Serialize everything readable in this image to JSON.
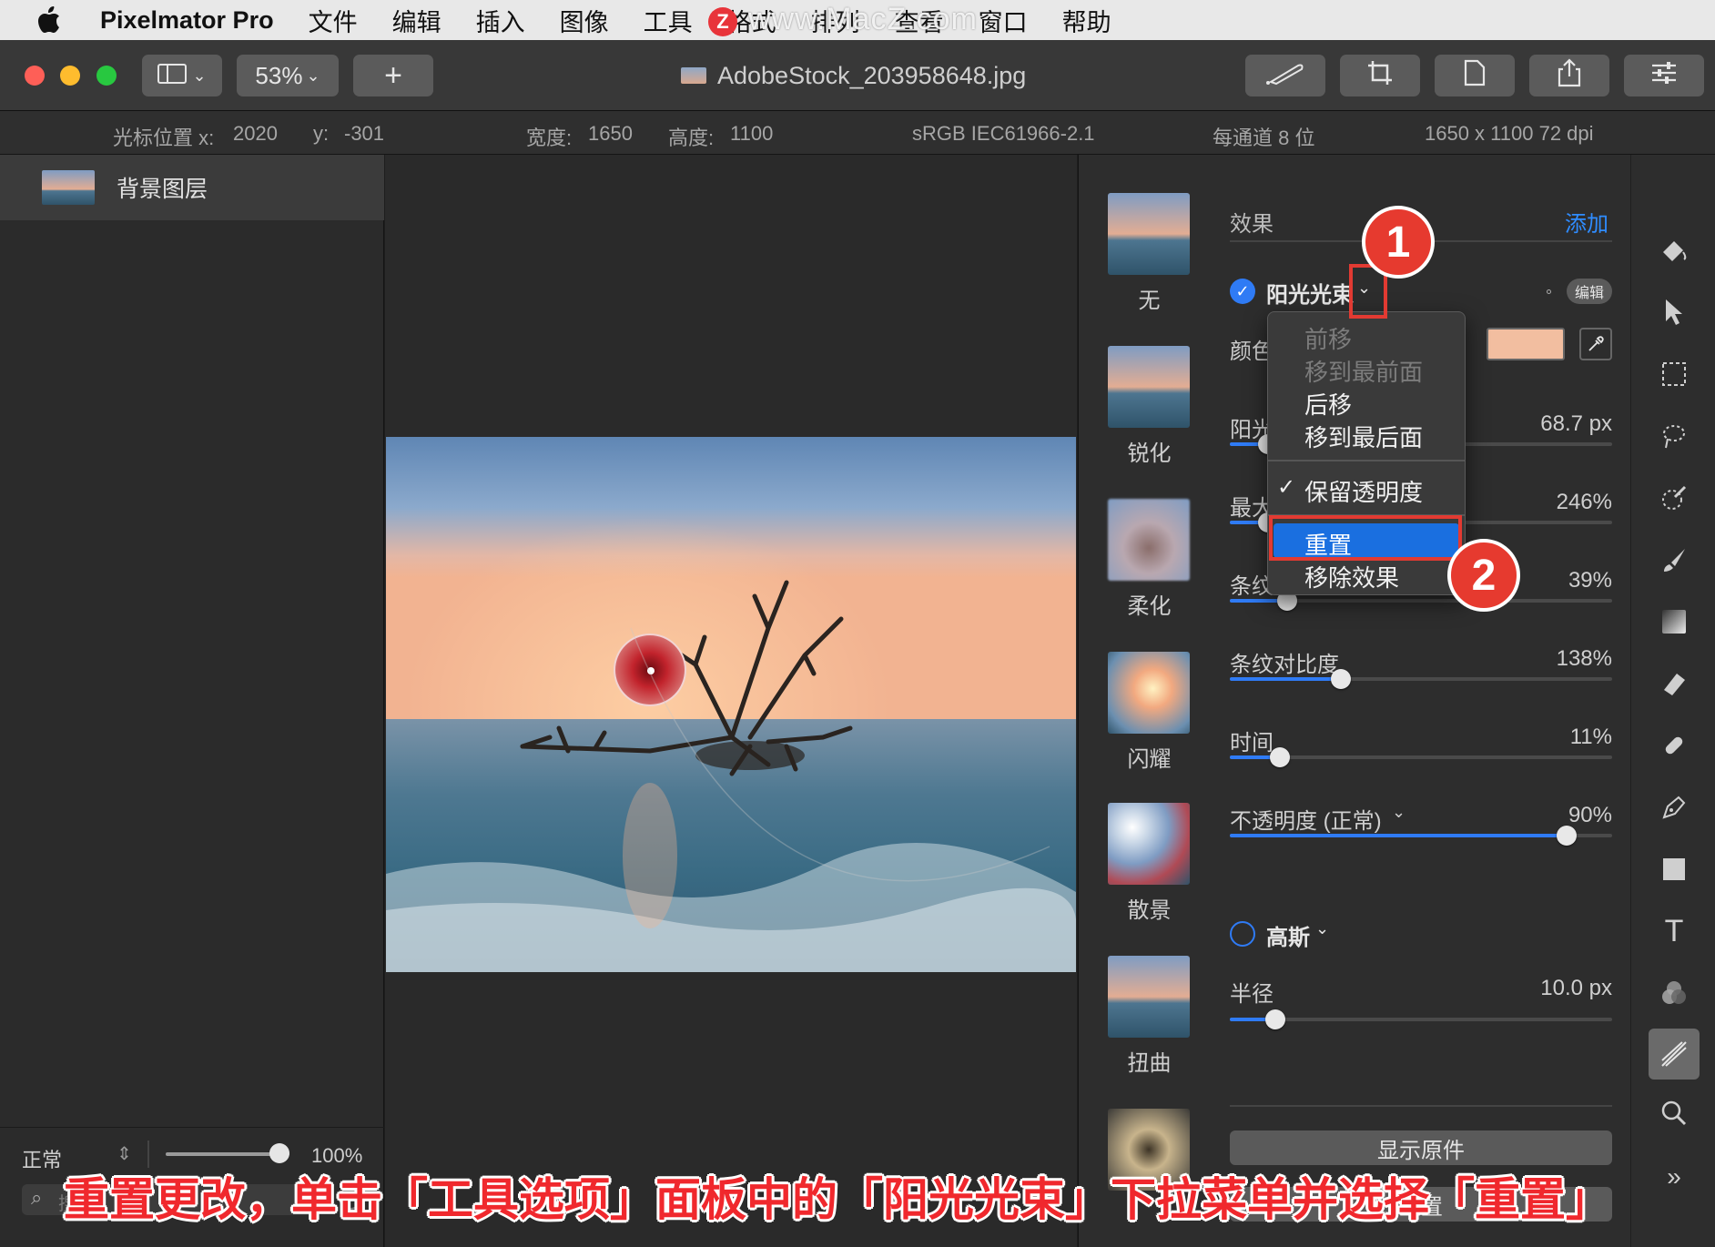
{
  "menubar": {
    "app_name": "Pixelmator Pro",
    "menus": [
      "文件",
      "编辑",
      "插入",
      "图像",
      "工具",
      "格式",
      "排列",
      "查看",
      "窗口",
      "帮助"
    ],
    "watermark": "www.MacZ.com",
    "watermark_logo": "Z"
  },
  "toolbar": {
    "zoom": "53%",
    "add_label": "+",
    "document_title": "AdobeStock_203958648.jpg"
  },
  "infobar": {
    "cursor_x_label": "光标位置 x:",
    "cursor_x": "2020",
    "cursor_y_label": "y:",
    "cursor_y": "-301",
    "width_label": "宽度:",
    "width": "1650",
    "height_label": "高度:",
    "height": "1100",
    "color_profile": "sRGB IEC61966-2.1",
    "bit_depth": "每通道 8 位",
    "dimensions": "1650 x 1100 72 dpi"
  },
  "layers": {
    "items": [
      {
        "name": "背景图层"
      }
    ],
    "blend_mode": "正常",
    "opacity": "100%",
    "search_placeholder": "搜索"
  },
  "browser": {
    "items": [
      {
        "label": "无"
      },
      {
        "label": "锐化"
      },
      {
        "label": "柔化"
      },
      {
        "label": "闪耀"
      },
      {
        "label": "散景"
      },
      {
        "label": "扭曲"
      }
    ]
  },
  "options": {
    "section_title": "效果",
    "add_label": "添加",
    "effect_name": "阳光光束",
    "edit_badge": "编辑",
    "color_label": "颜色",
    "color_value": "#f2bea0",
    "rows": [
      {
        "label": "阳光",
        "value": "68.7 px",
        "fill": 0.1
      },
      {
        "label": "最大",
        "value": "246%",
        "fill": 0.1
      },
      {
        "label": "条纹",
        "value": "39%",
        "fill": 0.15
      },
      {
        "label": "条纹对比度",
        "value": "138%",
        "fill": 0.29
      },
      {
        "label": "时间",
        "value": "11%",
        "fill": 0.13
      },
      {
        "label": "不透明度 (正常)",
        "value": "90%",
        "fill": 0.88
      }
    ],
    "second_effect_name": "高斯",
    "radius_label": "半径",
    "radius_value": "10.0 px",
    "radius_fill": 0.12,
    "show_original": "显示原件",
    "reset_button": "重置"
  },
  "popup": {
    "items": [
      {
        "label": "前移",
        "enabled": false
      },
      {
        "label": "移到最前面",
        "enabled": false
      },
      {
        "label": "后移",
        "enabled": true
      },
      {
        "label": "移到最后面",
        "enabled": true
      },
      {
        "label": "保留透明度",
        "enabled": true,
        "checked": true
      },
      {
        "label": "重置",
        "enabled": true,
        "highlighted": true
      },
      {
        "label": "移除效果",
        "enabled": true
      }
    ]
  },
  "annotations": {
    "badge1": "1",
    "badge2": "2",
    "caption": "重置更改，单击「工具选项」面板中的「阳光光束」下拉菜单并选择「重置」"
  },
  "colors": {
    "accent": "#2f7bf5",
    "highlight": "#1a6fe0",
    "annotation_red": "#e23a32"
  }
}
